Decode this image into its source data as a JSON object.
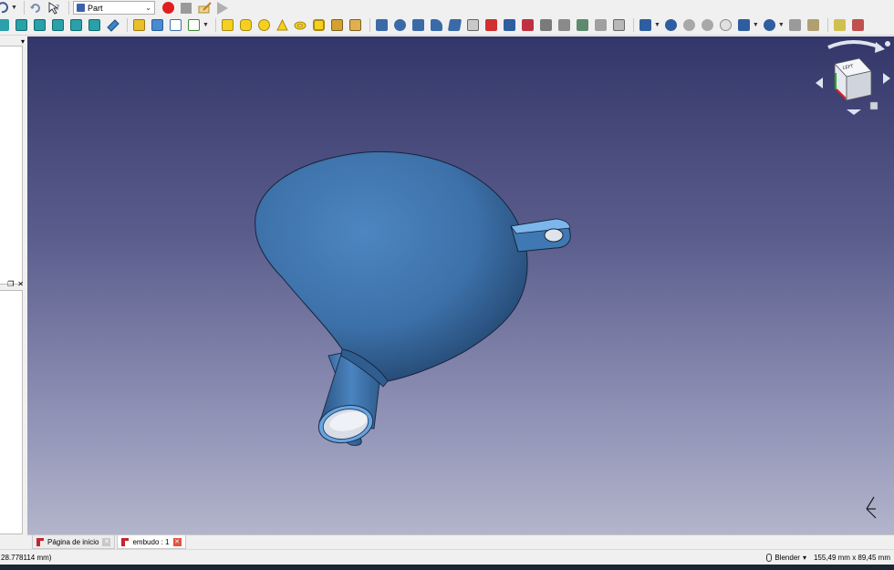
{
  "toolbar": {
    "workbench_value": "Part"
  },
  "doc_tabs": [
    {
      "label": "Página de inicio",
      "active": false
    },
    {
      "label": "embudo : 1",
      "active": true
    }
  ],
  "status_bar": {
    "left_text": "28.778114 mm)",
    "navigation_style": "Blender",
    "dimensions": "155,49 mm x 89,45 mm"
  },
  "nav_cube": {
    "face_label": "LEFT"
  },
  "colors": {
    "part_blue": "#3f76ad",
    "background_top": "#333669",
    "background_bottom": "#b3b5cc",
    "record_red": "#e01e1e"
  }
}
